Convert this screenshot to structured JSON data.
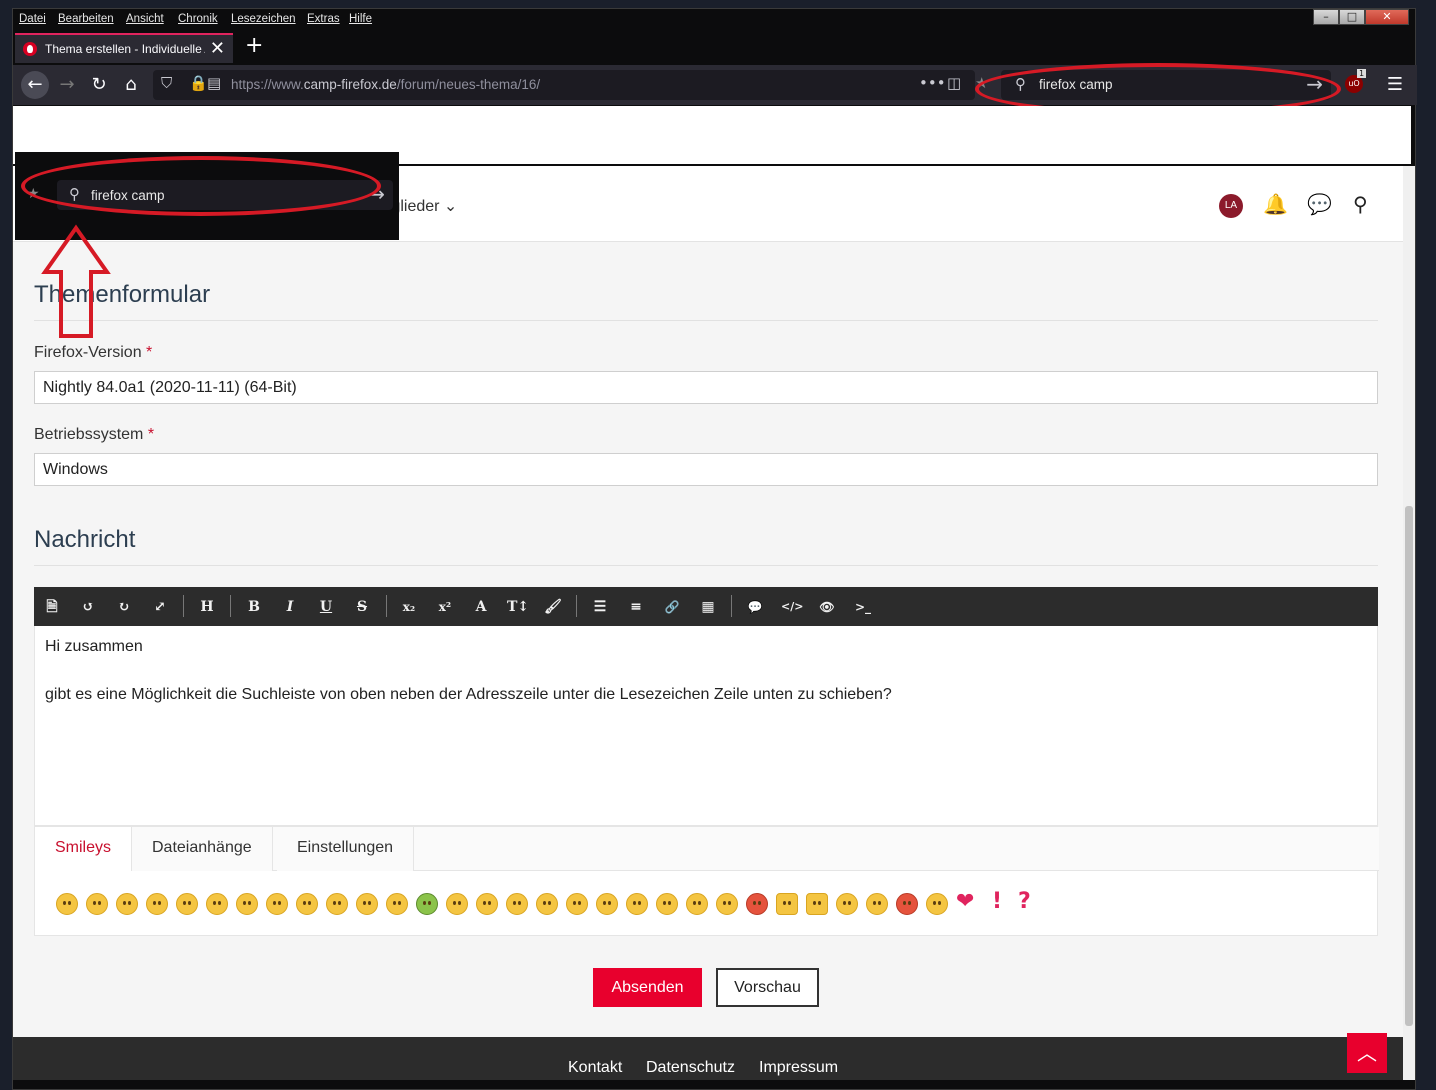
{
  "menu": [
    "Datei",
    "Bearbeiten",
    "Ansicht",
    "Chronik",
    "Lesezeichen",
    "Extras",
    "Hilfe"
  ],
  "window_controls": {
    "minimize": "–",
    "maximize": "□",
    "close": "✕"
  },
  "tab": {
    "title": "Thema erstellen - Individuelle A",
    "close": "✕",
    "new_tab": "+"
  },
  "nav": {
    "url_prefix": "https://www.",
    "url_domain": "camp-firefox.de",
    "url_path": "/forum/neues-thema/16/",
    "search_value": "firefox camp",
    "badge_count": "1"
  },
  "overlay_search_value": "firefox camp",
  "site_header": {
    "members_label": "tglieder ⌄",
    "avatar_initials": "LA"
  },
  "form": {
    "section_title": "Themenformular",
    "firefox_label": "Firefox-Version",
    "firefox_value": "Nightly 84.0a1 (2020-11-11) (64-Bit)",
    "os_label": "Betriebssystem",
    "os_value": "Windows",
    "required_mark": "*"
  },
  "message": {
    "section_title": "Nachricht",
    "line1": "Hi zusammen",
    "line2": "gibt es eine Möglichkeit die Suchleiste von oben neben der Adresszeile unter die Lesezeichen Zeile unten zu schieben?"
  },
  "toolbar_buttons": [
    "🗎",
    "↺",
    "↻",
    "⤢",
    "H",
    "B",
    "I",
    "U",
    "S",
    "x₂",
    "x²",
    "A",
    "T↕",
    "🖌",
    "☰",
    "≡",
    "🔗",
    "▦",
    "💬",
    "</>",
    "👁",
    ">_"
  ],
  "bottom_tabs": [
    "Smileys",
    "Dateianhänge",
    "Einstellungen"
  ],
  "smiley_glyphs": {
    "heart": "❤",
    "exclaim": "!",
    "question": "?"
  },
  "buttons": {
    "submit": "Absenden",
    "preview": "Vorschau"
  },
  "footer": [
    "Kontakt",
    "Datenschutz",
    "Impressum"
  ],
  "colors": {
    "accent_red": "#e8002d",
    "annotation_red": "#d61a25",
    "toolbar_dark": "#2c2c2c"
  }
}
